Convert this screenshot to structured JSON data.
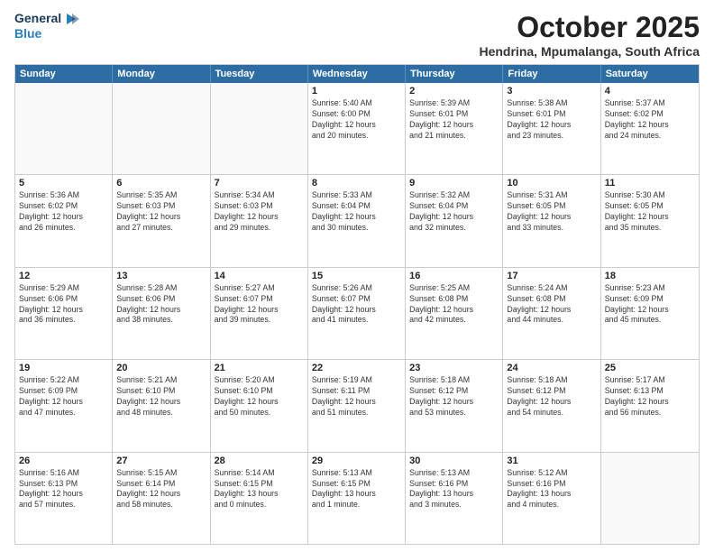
{
  "logo": {
    "line1": "General",
    "line2": "Blue"
  },
  "title": "October 2025",
  "subtitle": "Hendrina, Mpumalanga, South Africa",
  "header_days": [
    "Sunday",
    "Monday",
    "Tuesday",
    "Wednesday",
    "Thursday",
    "Friday",
    "Saturday"
  ],
  "weeks": [
    [
      {
        "day": "",
        "info": ""
      },
      {
        "day": "",
        "info": ""
      },
      {
        "day": "",
        "info": ""
      },
      {
        "day": "1",
        "info": "Sunrise: 5:40 AM\nSunset: 6:00 PM\nDaylight: 12 hours\nand 20 minutes."
      },
      {
        "day": "2",
        "info": "Sunrise: 5:39 AM\nSunset: 6:01 PM\nDaylight: 12 hours\nand 21 minutes."
      },
      {
        "day": "3",
        "info": "Sunrise: 5:38 AM\nSunset: 6:01 PM\nDaylight: 12 hours\nand 23 minutes."
      },
      {
        "day": "4",
        "info": "Sunrise: 5:37 AM\nSunset: 6:02 PM\nDaylight: 12 hours\nand 24 minutes."
      }
    ],
    [
      {
        "day": "5",
        "info": "Sunrise: 5:36 AM\nSunset: 6:02 PM\nDaylight: 12 hours\nand 26 minutes."
      },
      {
        "day": "6",
        "info": "Sunrise: 5:35 AM\nSunset: 6:03 PM\nDaylight: 12 hours\nand 27 minutes."
      },
      {
        "day": "7",
        "info": "Sunrise: 5:34 AM\nSunset: 6:03 PM\nDaylight: 12 hours\nand 29 minutes."
      },
      {
        "day": "8",
        "info": "Sunrise: 5:33 AM\nSunset: 6:04 PM\nDaylight: 12 hours\nand 30 minutes."
      },
      {
        "day": "9",
        "info": "Sunrise: 5:32 AM\nSunset: 6:04 PM\nDaylight: 12 hours\nand 32 minutes."
      },
      {
        "day": "10",
        "info": "Sunrise: 5:31 AM\nSunset: 6:05 PM\nDaylight: 12 hours\nand 33 minutes."
      },
      {
        "day": "11",
        "info": "Sunrise: 5:30 AM\nSunset: 6:05 PM\nDaylight: 12 hours\nand 35 minutes."
      }
    ],
    [
      {
        "day": "12",
        "info": "Sunrise: 5:29 AM\nSunset: 6:06 PM\nDaylight: 12 hours\nand 36 minutes."
      },
      {
        "day": "13",
        "info": "Sunrise: 5:28 AM\nSunset: 6:06 PM\nDaylight: 12 hours\nand 38 minutes."
      },
      {
        "day": "14",
        "info": "Sunrise: 5:27 AM\nSunset: 6:07 PM\nDaylight: 12 hours\nand 39 minutes."
      },
      {
        "day": "15",
        "info": "Sunrise: 5:26 AM\nSunset: 6:07 PM\nDaylight: 12 hours\nand 41 minutes."
      },
      {
        "day": "16",
        "info": "Sunrise: 5:25 AM\nSunset: 6:08 PM\nDaylight: 12 hours\nand 42 minutes."
      },
      {
        "day": "17",
        "info": "Sunrise: 5:24 AM\nSunset: 6:08 PM\nDaylight: 12 hours\nand 44 minutes."
      },
      {
        "day": "18",
        "info": "Sunrise: 5:23 AM\nSunset: 6:09 PM\nDaylight: 12 hours\nand 45 minutes."
      }
    ],
    [
      {
        "day": "19",
        "info": "Sunrise: 5:22 AM\nSunset: 6:09 PM\nDaylight: 12 hours\nand 47 minutes."
      },
      {
        "day": "20",
        "info": "Sunrise: 5:21 AM\nSunset: 6:10 PM\nDaylight: 12 hours\nand 48 minutes."
      },
      {
        "day": "21",
        "info": "Sunrise: 5:20 AM\nSunset: 6:10 PM\nDaylight: 12 hours\nand 50 minutes."
      },
      {
        "day": "22",
        "info": "Sunrise: 5:19 AM\nSunset: 6:11 PM\nDaylight: 12 hours\nand 51 minutes."
      },
      {
        "day": "23",
        "info": "Sunrise: 5:18 AM\nSunset: 6:12 PM\nDaylight: 12 hours\nand 53 minutes."
      },
      {
        "day": "24",
        "info": "Sunrise: 5:18 AM\nSunset: 6:12 PM\nDaylight: 12 hours\nand 54 minutes."
      },
      {
        "day": "25",
        "info": "Sunrise: 5:17 AM\nSunset: 6:13 PM\nDaylight: 12 hours\nand 56 minutes."
      }
    ],
    [
      {
        "day": "26",
        "info": "Sunrise: 5:16 AM\nSunset: 6:13 PM\nDaylight: 12 hours\nand 57 minutes."
      },
      {
        "day": "27",
        "info": "Sunrise: 5:15 AM\nSunset: 6:14 PM\nDaylight: 12 hours\nand 58 minutes."
      },
      {
        "day": "28",
        "info": "Sunrise: 5:14 AM\nSunset: 6:15 PM\nDaylight: 13 hours\nand 0 minutes."
      },
      {
        "day": "29",
        "info": "Sunrise: 5:13 AM\nSunset: 6:15 PM\nDaylight: 13 hours\nand 1 minute."
      },
      {
        "day": "30",
        "info": "Sunrise: 5:13 AM\nSunset: 6:16 PM\nDaylight: 13 hours\nand 3 minutes."
      },
      {
        "day": "31",
        "info": "Sunrise: 5:12 AM\nSunset: 6:16 PM\nDaylight: 13 hours\nand 4 minutes."
      },
      {
        "day": "",
        "info": ""
      }
    ]
  ]
}
